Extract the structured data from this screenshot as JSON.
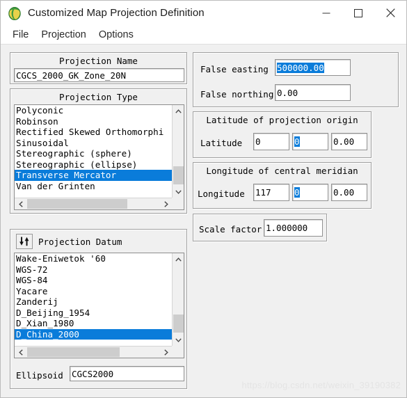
{
  "window": {
    "title": "Customized Map Projection Definition",
    "icon": "globe-icon",
    "minimize_label": "—",
    "maximize_label": "☐",
    "close_label": "✕"
  },
  "menubar": {
    "items": [
      {
        "label": "File",
        "name": "menu-file"
      },
      {
        "label": "Projection",
        "name": "menu-projection"
      },
      {
        "label": "Options",
        "name": "menu-options"
      }
    ]
  },
  "projection_name": {
    "group_title": "Projection Name",
    "value": "CGCS_2000_GK_Zone_20N"
  },
  "projection_type": {
    "group_title": "Projection Type",
    "items": [
      "Polyconic",
      "Robinson",
      "Rectified Skewed Orthomorphi",
      "Sinusoidal",
      "Stereographic (sphere)",
      "Stereographic (ellipse)",
      "Transverse Mercator",
      "Van der Grinten"
    ],
    "selected": "Transverse Mercator",
    "selected_index": 6
  },
  "projection_datum": {
    "group_title": "Projection Datum",
    "sort_icon": "sort-updown-icon",
    "items": [
      "Wake-Eniwetok '60",
      "WGS-72",
      "WGS-84",
      "Yacare",
      "Zanderij",
      "D_Beijing_1954",
      "D_Xian_1980",
      "D_China_2000"
    ],
    "selected": "D_China_2000",
    "selected_index": 7,
    "ellipsoid_label": "Ellipsoid",
    "ellipsoid_value": "CGCS2000"
  },
  "false_offsets": {
    "easting_label": "False easting",
    "easting_value": "500000.00",
    "easting_selected": true,
    "northing_label": "False northing",
    "northing_value": "0.00"
  },
  "latitude_origin": {
    "group_title": "Latitude of projection origin",
    "label": "Latitude",
    "degrees": "0",
    "minutes": "0",
    "seconds": "0.00",
    "minutes_selected": true
  },
  "longitude_meridian": {
    "group_title": "Longitude of central meridian",
    "label": "Longitude",
    "degrees": "117",
    "minutes": "0",
    "seconds": "0.00",
    "minutes_selected": true
  },
  "scale_factor": {
    "label": "Scale factor",
    "value": "1.000000"
  },
  "watermark": {
    "text": "https://blog.csdn.net/weixin_39190382"
  },
  "colors": {
    "selection_blue": "#0a7cda",
    "window_bg": "#f0f0f0",
    "field_bg": "#ffffff",
    "border": "#a0a0a0"
  }
}
